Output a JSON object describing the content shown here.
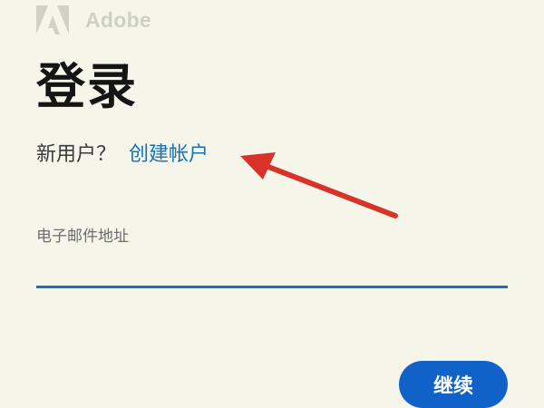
{
  "brand": {
    "logo_icon": "adobe-logo-icon",
    "name": "Adobe"
  },
  "page": {
    "title": "登录"
  },
  "signup": {
    "prompt": "新用户？",
    "link_label": "创建帐户"
  },
  "annotation": {
    "arrow_icon": "red-arrow-icon",
    "color": "#d7332a"
  },
  "email": {
    "label": "电子邮件地址",
    "value": "",
    "placeholder": ""
  },
  "actions": {
    "continue_label": "继续"
  },
  "colors": {
    "background": "#f5f6e9",
    "accent": "#1473b9",
    "button": "#1062c9"
  }
}
